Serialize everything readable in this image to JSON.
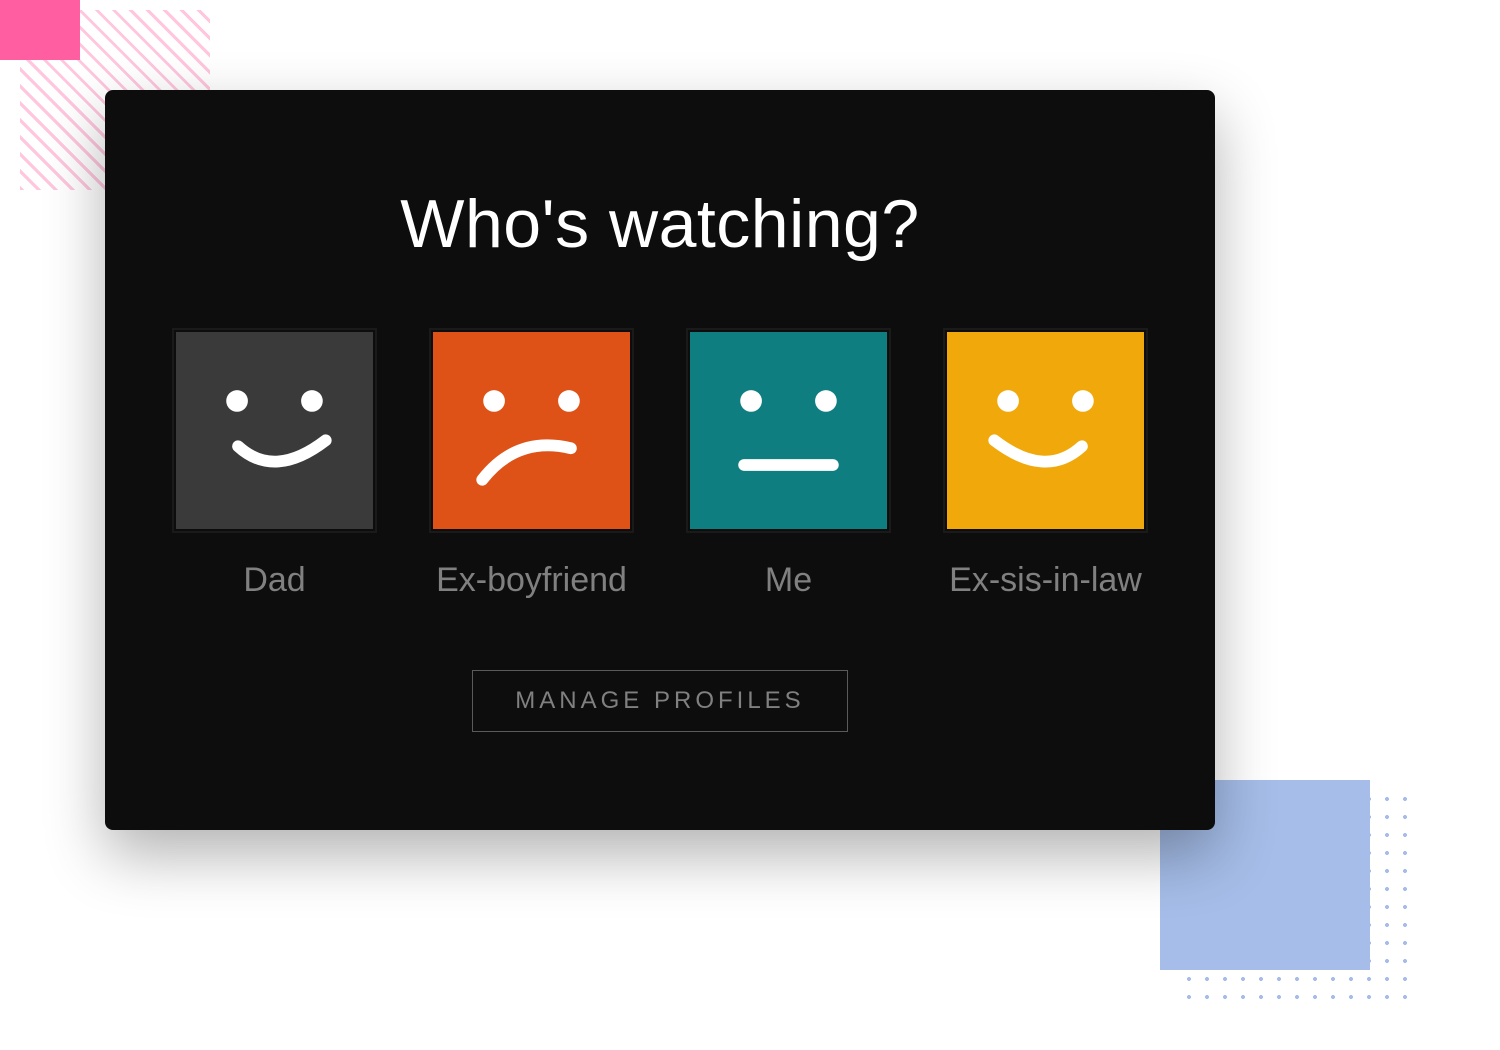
{
  "heading": "Who's watching?",
  "profiles": [
    {
      "name": "Dad",
      "avatar_color": "dark",
      "expression": "smile",
      "icon": "smile-face-icon"
    },
    {
      "name": "Ex-boyfriend",
      "avatar_color": "orange",
      "expression": "frown",
      "icon": "frown-face-icon"
    },
    {
      "name": "Me",
      "avatar_color": "teal",
      "expression": "neutral",
      "icon": "neutral-face-icon"
    },
    {
      "name": "Ex-sis-in-law",
      "avatar_color": "yellow",
      "expression": "smile",
      "icon": "smile-face-icon"
    }
  ],
  "manage_button_label": "MANAGE PROFILES",
  "colors": {
    "card_bg": "#0d0d0d",
    "heading": "#ffffff",
    "name": "#808080",
    "avatar_dark": "#3a3a3a",
    "avatar_orange": "#de5217",
    "avatar_teal": "#0f7e80",
    "avatar_yellow": "#f1a80b",
    "accent_pink": "#ff5fa0",
    "accent_blue": "#a5bde8"
  }
}
